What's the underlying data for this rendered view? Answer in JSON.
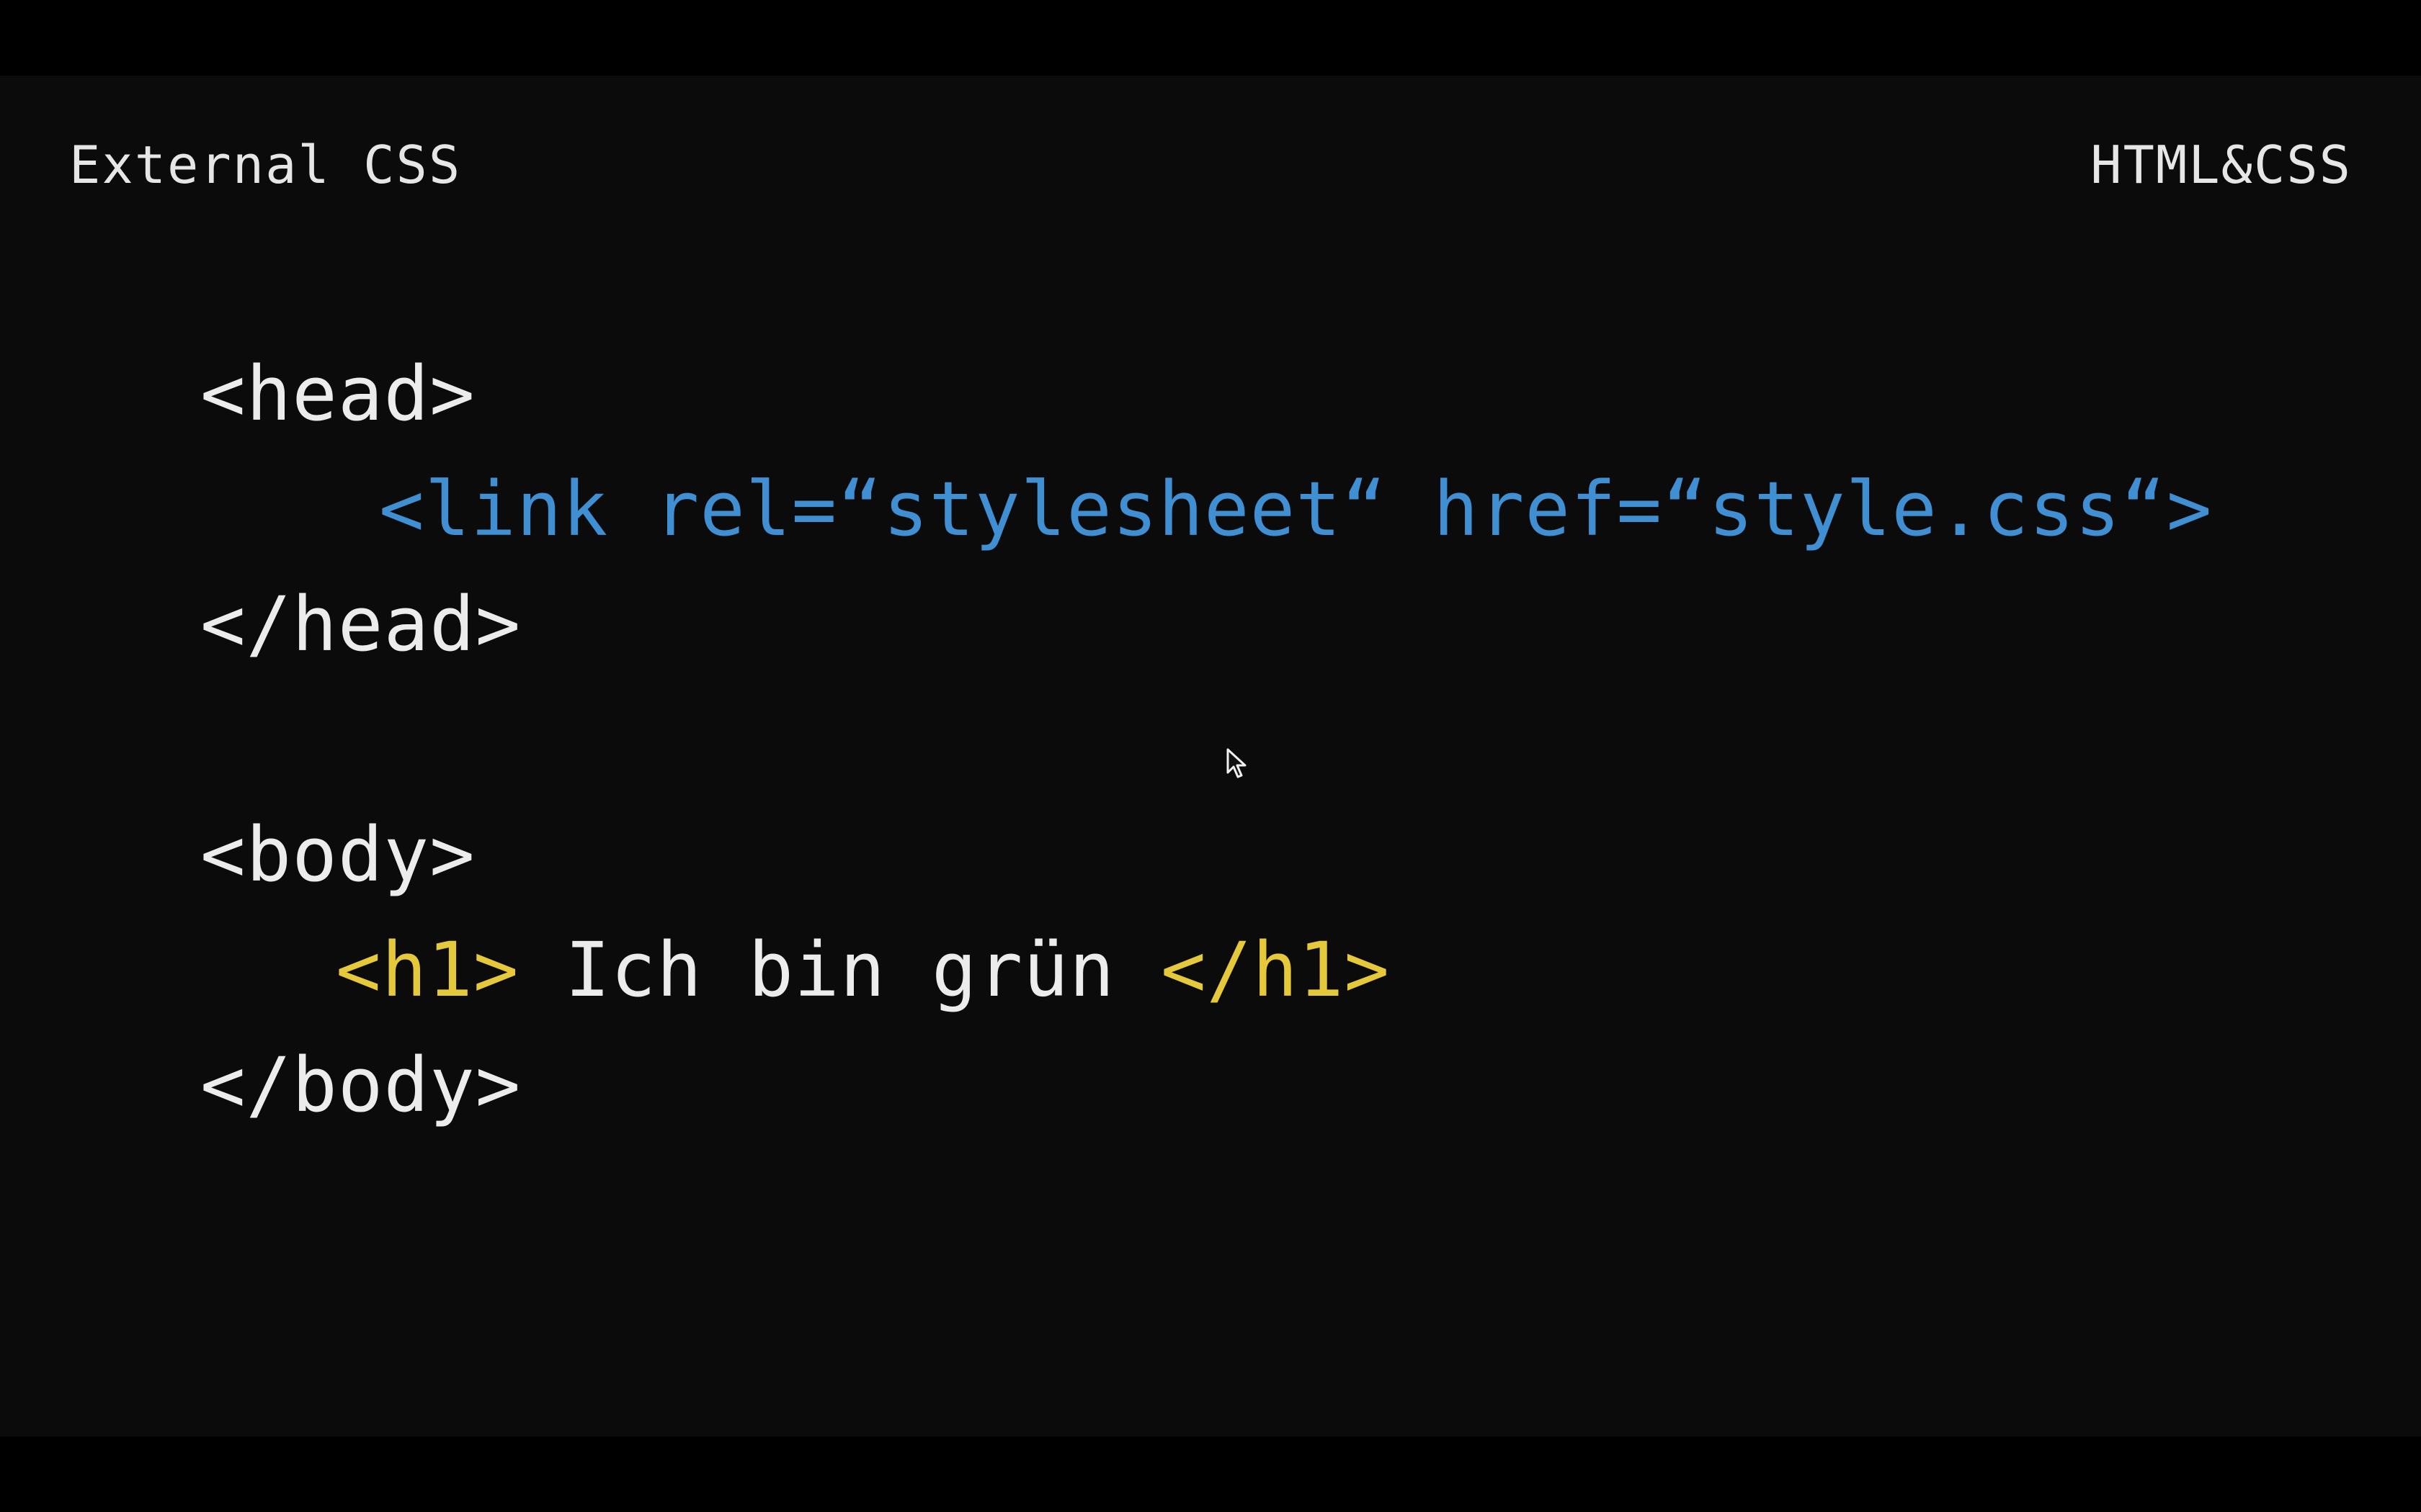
{
  "slide": {
    "title": "External CSS",
    "course": "HTML&CSS"
  },
  "code": {
    "head_open": "<head>",
    "link_tag": "<link rel=“stylesheet“ href=“style.css“>",
    "head_close": "</head>",
    "body_open": "<body>",
    "h1_open": "<h1>",
    "h1_text": " Ich bin grün ",
    "h1_close": "</h1>",
    "body_close": "</body>"
  },
  "colors": {
    "background": "#0b0b0b",
    "text": "#ececec",
    "link_tag": "#3f8fd2",
    "h1_tag": "#e6c93a"
  },
  "icons": {
    "cursor": "mouse-pointer-icon"
  }
}
